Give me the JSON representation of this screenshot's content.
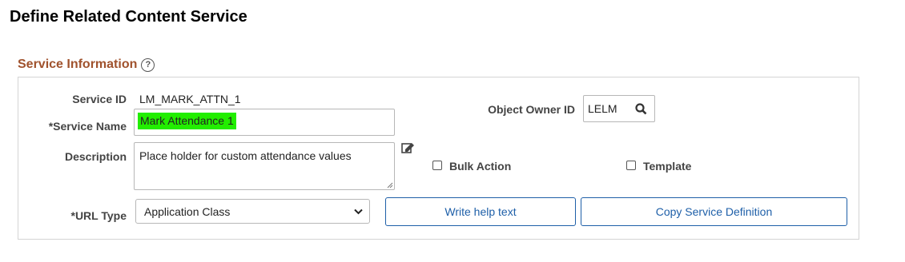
{
  "page": {
    "title": "Define Related Content Service"
  },
  "section": {
    "title": "Service Information",
    "help_glyph": "?"
  },
  "fields": {
    "service_id": {
      "label": "Service ID",
      "value": "LM_MARK_ATTN_1"
    },
    "service_name": {
      "label": "*Service Name",
      "value": "Mark Attendance 1"
    },
    "description": {
      "label": "Description",
      "value": "Place holder for custom attendance values"
    },
    "url_type": {
      "label": "*URL Type",
      "value": "Application Class"
    },
    "object_owner_id": {
      "label": "Object Owner ID",
      "value": "LELM"
    }
  },
  "checkboxes": {
    "bulk_action": {
      "label": "Bulk Action",
      "checked": false
    },
    "template": {
      "label": "Template",
      "checked": false
    }
  },
  "buttons": {
    "write_help": "Write help text",
    "copy_definition": "Copy Service Definition"
  },
  "icons": {
    "help": "help-icon",
    "edit": "edit-icon",
    "search": "search-icon",
    "dropdown": "chevron-down-icon"
  },
  "colors": {
    "section_title": "#a0522d",
    "highlight": "#22ee00",
    "button_text": "#1e5fa8"
  }
}
